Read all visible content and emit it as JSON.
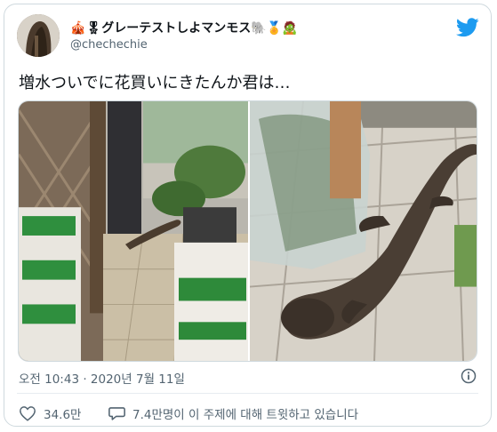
{
  "tweet": {
    "display_name": "🎪🎖グレーテストしよマンモス🐘🏅🧟",
    "handle": "@chechechie",
    "text": "増水ついでに花買いにきたんか君は…",
    "timestamp": "오전 10:43 · 2020년 7월 11일"
  },
  "actions": {
    "likes": "34.6만",
    "discussion": "7.4만명이 이 주제에 대해 트윗하고 있습니다"
  },
  "icons": {
    "brand": "twitter-bird-icon",
    "info": "info-icon",
    "like": "heart-icon",
    "reply": "speech-bubble-icon"
  },
  "colors": {
    "brand": "#1d9bf0",
    "muted_text": "#536471",
    "border": "#cfd9de"
  }
}
